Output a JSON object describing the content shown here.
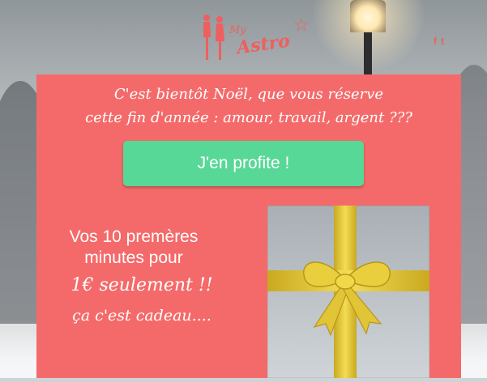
{
  "header": {
    "logo": {
      "my": "My",
      "astro": "Astro"
    },
    "social": [
      "f",
      "t"
    ]
  },
  "main": {
    "headline": [
      "C'est bientôt Noël, que vous réserve",
      "cette fin d'année : amour, travail, argent ???"
    ],
    "cta_label": "J'en profite !",
    "promo": {
      "line1": "Vos 10 premères",
      "line2": "minutes pour",
      "line3": "1€ seulement !!",
      "line4": "ça c'est cadeau...."
    }
  },
  "colors": {
    "card": "#f46a6a",
    "cta": "#58d896",
    "brand": "#ef5f5f",
    "ribbon": "#e9d24a"
  },
  "icons": [
    "logo-couple-icon",
    "star-icon",
    "facebook-icon",
    "twitter-icon",
    "gift-box-icon"
  ]
}
